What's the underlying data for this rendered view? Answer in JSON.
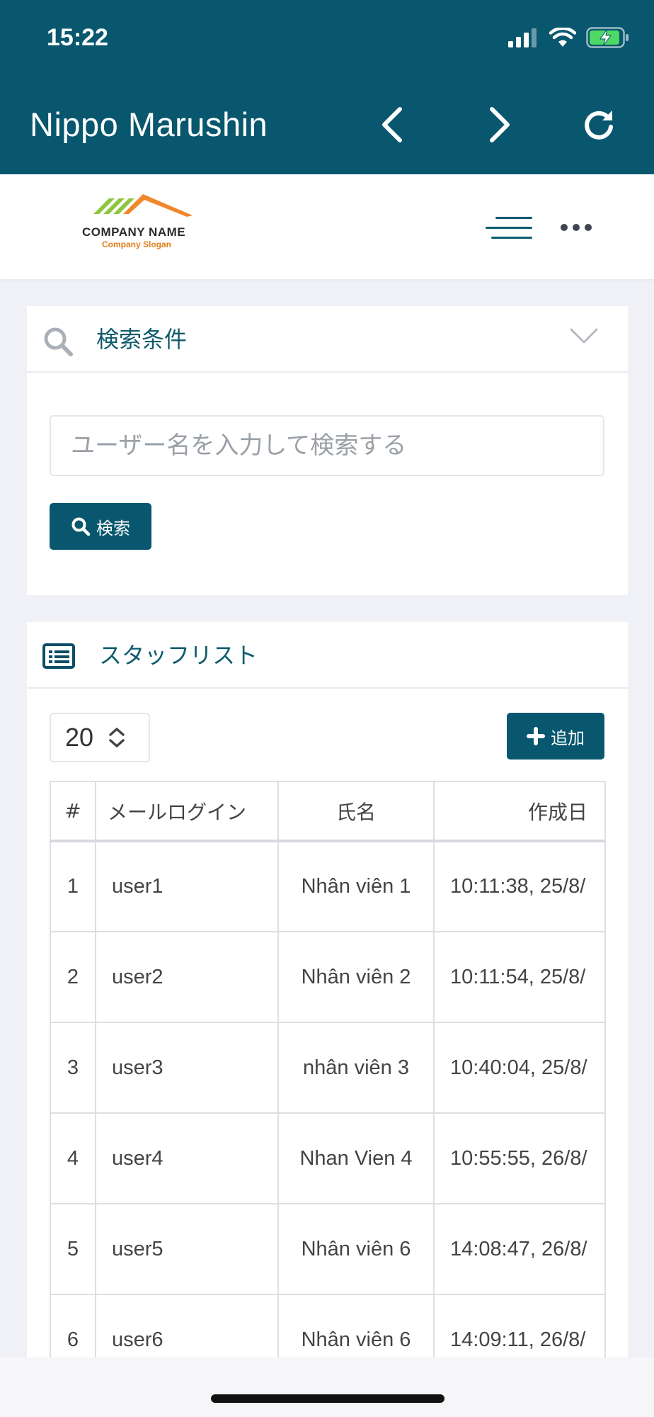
{
  "status": {
    "time": "15:22"
  },
  "app": {
    "title": "Nippo Marushin",
    "back_icon": "chevron-left-icon",
    "forward_icon": "chevron-right-icon",
    "reload_icon": "reload-icon"
  },
  "site": {
    "logo_name": "COMPANY NAME",
    "logo_slogan": "Company Slogan",
    "logo_colors": {
      "green": "#8dc63f",
      "orange": "#f0872a"
    }
  },
  "search": {
    "title": "検索条件",
    "placeholder": "ユーザー名を入力して検索する",
    "button_label": "検索"
  },
  "staff": {
    "title": "スタッフリスト",
    "page_size": "20",
    "add_label": "追加",
    "columns": [
      "#",
      "メールログイン",
      "氏名",
      "作成日"
    ],
    "rows": [
      {
        "num": "1",
        "mail": "user1",
        "name": "Nhân viên 1",
        "date": "10:11:38, 25/8/"
      },
      {
        "num": "2",
        "mail": "user2",
        "name": "Nhân viên 2",
        "date": "10:11:54, 25/8/"
      },
      {
        "num": "3",
        "mail": "user3",
        "name": "nhân viên 3",
        "date": "10:40:04, 25/8/"
      },
      {
        "num": "4",
        "mail": "user4",
        "name": "Nhan Vien 4",
        "date": "10:55:55, 26/8/"
      },
      {
        "num": "5",
        "mail": "user5",
        "name": "Nhân viên 6",
        "date": "14:08:47, 26/8/"
      },
      {
        "num": "6",
        "mail": "user6",
        "name": "Nhân viên 6",
        "date": "14:09:11, 26/8/"
      }
    ]
  },
  "theme": {
    "primary": "#08576e",
    "background": "#eff1f6"
  }
}
